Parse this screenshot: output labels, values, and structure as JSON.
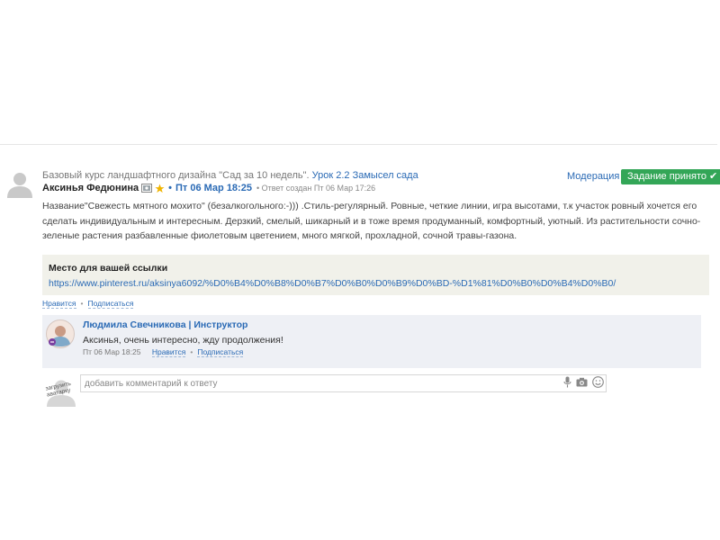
{
  "post": {
    "course_text": "Базовый курс ландшафтного дизайна \"Сад за 10 недель\".",
    "lesson_link": "Урок 2.2 Замысел сада",
    "moderation_label": "Модерация",
    "accepted_label": "Задание принято",
    "author": "Аксинья Федюнина",
    "date": "Пт 06 Мар 18:25",
    "created_note": "• Ответ создан Пт 06 Мар 17:26",
    "text": "Название\"Свежесть мятного мохито\" (безалкогольного:-))) .Стиль-регулярный. Ровные, четкие линии, игра высотами, т.к участок ровный хочется его сделать индивидуальным и интересным. Дерзкий, смелый, шикарный и в тоже время продуманный, комфортный, уютный. Из растительности сочно-зеленые растения разбавленные фиолетовым цветением, много мягкой, прохладной, сочной травы-газона.",
    "link_box_title": "Место для вашей ссылки",
    "link_url": "https://www.pinterest.ru/aksinya6092/%D0%B4%D0%B8%D0%B7%D0%B0%D0%B9%D0%BD-%D1%81%D0%B0%D0%B4%D0%B0/",
    "like_label": "Нравится",
    "subscribe_label": "Подписаться"
  },
  "reply": {
    "author": "Людмила Свечникова | Инструктор",
    "text": "Аксинья, очень интересно, жду продолжения!",
    "date": "Пт 06 Мар 18:25",
    "like_label": "Нравится",
    "subscribe_label": "Подписаться"
  },
  "comment": {
    "upload_avatar_label": "загрузить аватарку",
    "placeholder": "добавить комментарий к ответу"
  },
  "colors": {
    "accent": "#2a6ab5",
    "accepted": "#33a657",
    "link_box_bg": "#f1f1ea",
    "reply_bg": "#eef0f5"
  }
}
